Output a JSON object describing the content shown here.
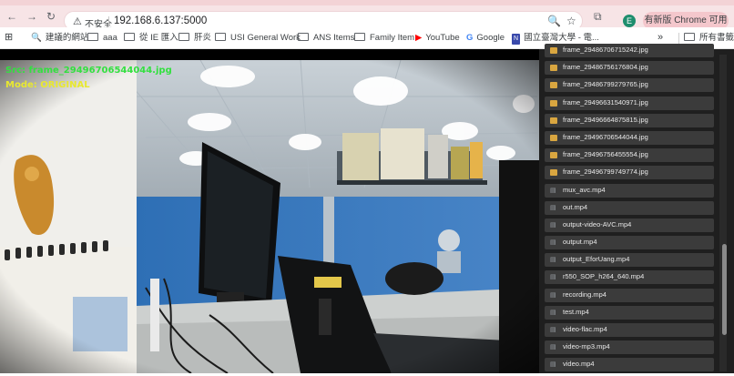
{
  "browser": {
    "url": "192.168.6.137:5000",
    "security_label": "不安全",
    "profile_initial": "E",
    "update_button": "有新版 Chrome 可用"
  },
  "bookmarks": {
    "items": [
      "建議的網站",
      "aaa",
      "從 IE 匯入",
      "肝炎",
      "USI General Work",
      "ANS Items",
      "Family Item",
      "YouTube",
      "Google",
      "國立臺灣大學 - 電..."
    ],
    "overflow": "»",
    "all_bookmarks": "所有書籤"
  },
  "video": {
    "src_label": "Src: frame_29496706544044.jpg",
    "mode_label": "Mode: ORIGINAL"
  },
  "files": [
    {
      "name": "frame_29486706715242.jpg",
      "type": "image"
    },
    {
      "name": "frame_29486756176804.jpg",
      "type": "image"
    },
    {
      "name": "frame_29486799279765.jpg",
      "type": "image"
    },
    {
      "name": "frame_29496631540971.jpg",
      "type": "image"
    },
    {
      "name": "frame_29496664875815.jpg",
      "type": "image"
    },
    {
      "name": "frame_29496706544044.jpg",
      "type": "image"
    },
    {
      "name": "frame_29496756455554.jpg",
      "type": "image"
    },
    {
      "name": "frame_29496799749774.jpg",
      "type": "image"
    },
    {
      "name": "mux_avc.mp4",
      "type": "video"
    },
    {
      "name": "out.mp4",
      "type": "video"
    },
    {
      "name": "output-video-AVC.mp4",
      "type": "video"
    },
    {
      "name": "output.mp4",
      "type": "video"
    },
    {
      "name": "output_EforUang.mp4",
      "type": "video"
    },
    {
      "name": "r550_SOP_h264_640.mp4",
      "type": "video"
    },
    {
      "name": "recording.mp4",
      "type": "video"
    },
    {
      "name": "test.mp4",
      "type": "video"
    },
    {
      "name": "video-flac.mp4",
      "type": "video"
    },
    {
      "name": "video-mp3.mp4",
      "type": "video"
    },
    {
      "name": "video.mp4",
      "type": "video"
    }
  ]
}
